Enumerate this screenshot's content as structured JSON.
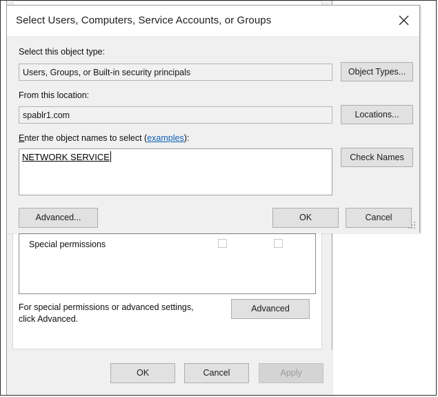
{
  "background_dialog": {
    "permissions_list": {
      "rows": [
        {
          "label": "Special permissions",
          "allow_checked": false,
          "deny_checked": false
        }
      ]
    },
    "advanced_note": {
      "line1": "For special permissions or advanced settings,",
      "line2": "click Advanced."
    },
    "advanced_button": "Advanced",
    "footer_buttons": [
      {
        "label": "OK",
        "enabled": true
      },
      {
        "label": "Cancel",
        "enabled": true
      },
      {
        "label": "Apply",
        "enabled": false
      }
    ]
  },
  "modal": {
    "title": "Select Users, Computers, Service Accounts, or Groups",
    "close_icon": "close-icon",
    "object_type": {
      "label": "Select this object type:",
      "value": "Users, Groups, or Built-in security principals",
      "button": "Object Types..."
    },
    "location": {
      "label": "From this location:",
      "value": "spablr1.com",
      "button": "Locations..."
    },
    "object_names": {
      "label_accel": "E",
      "label_before": "nter the object names to select (",
      "label_link": "examples",
      "label_after": "):",
      "value": "NETWORK SERVICE",
      "button": "Check Names"
    },
    "buttons": {
      "advanced": "Advanced...",
      "ok": "OK",
      "cancel": "Cancel"
    },
    "resize_grip": "resize-grip-icon"
  },
  "colors": {
    "link": "#0b5fb5",
    "dialog_face": "#f0f0f0",
    "button_face": "#e1e1e1",
    "field_face": "#f1f1f1",
    "disabled_text": "#9a9a9a"
  }
}
